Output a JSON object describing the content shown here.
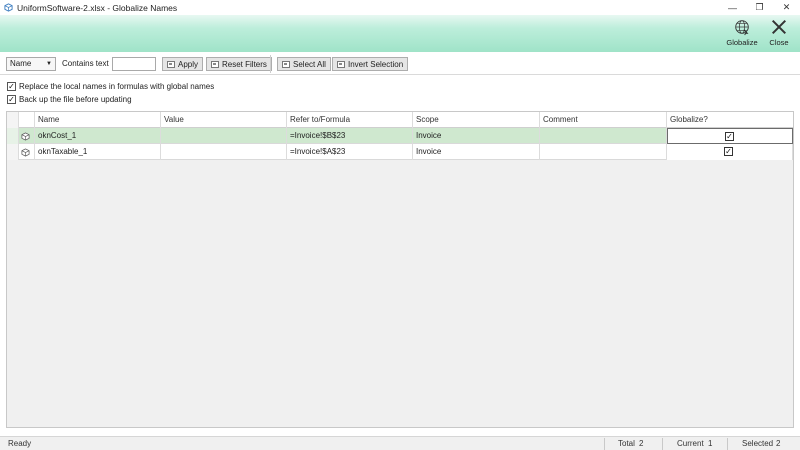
{
  "window": {
    "title": "UniformSoftware-2.xlsx - Globalize Names",
    "minimize": "—",
    "restore": "❐",
    "close": "✕"
  },
  "ribbon": {
    "globalize_label": "Globalize",
    "close_label": "Close"
  },
  "toolbar": {
    "filter_field": "Name",
    "contains_label": "Contains text",
    "contains_value": "",
    "apply_label": "Apply",
    "reset_label": "Reset Filters",
    "select_all_label": "Select All",
    "invert_label": "Invert Selection"
  },
  "options": {
    "replace_label": "Replace the local names in formulas with global names",
    "replace_checked": true,
    "backup_label": "Back up the file before updating",
    "backup_checked": true
  },
  "grid": {
    "columns": [
      "Name",
      "Value",
      "Refer to/Formula",
      "Scope",
      "Comment",
      "Globalize?"
    ],
    "rows": [
      {
        "name": "oknCost_1",
        "value": "",
        "formula": "=Invoice!$B$23",
        "scope": "Invoice",
        "comment": "",
        "globalize": true,
        "selected": true
      },
      {
        "name": "oknTaxable_1",
        "value": "",
        "formula": "=Invoice!$A$23",
        "scope": "Invoice",
        "comment": "",
        "globalize": true,
        "selected": false
      }
    ]
  },
  "status": {
    "state": "Ready",
    "total_label": "Total",
    "total_value": "2",
    "current_label": "Current",
    "current_value": "1",
    "selected_label": "Selected",
    "selected_value": "2"
  },
  "colors": {
    "ribbon_accent": "#9fe3c8",
    "selected_row": "#cfe8cf"
  },
  "icons": {
    "app": "spreadsheet-icon",
    "globalize": "globe-icon",
    "close": "close-icon",
    "row": "name-cube-icon"
  }
}
